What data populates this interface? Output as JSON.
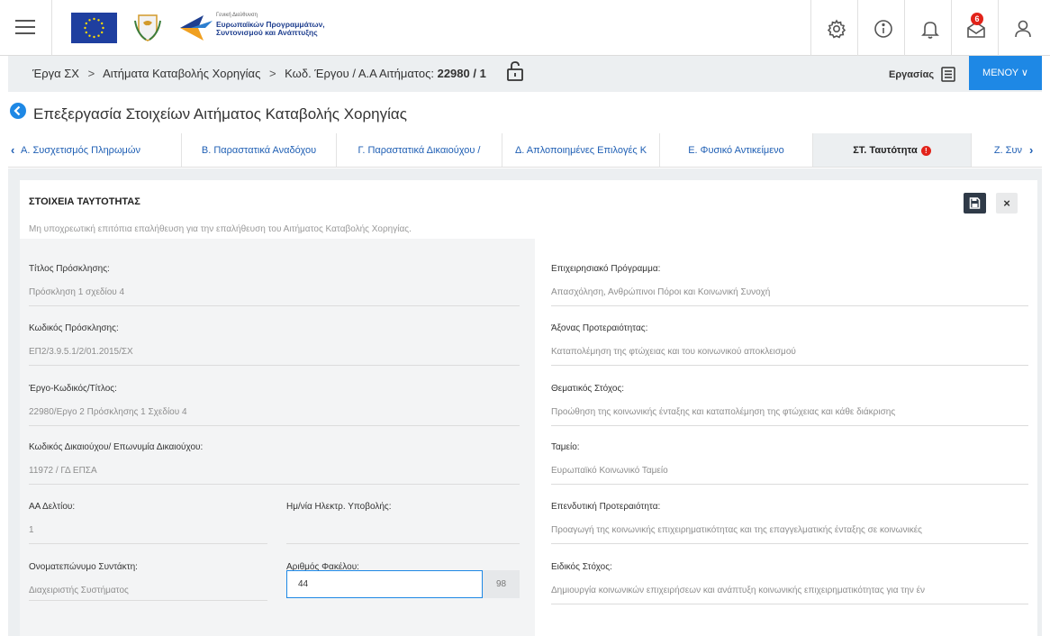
{
  "header": {
    "logo_line1": "Γενική Διεύθυνση",
    "logo_line2": "Ευρωπαϊκών Προγραμμάτων,",
    "logo_line3": "Συντονισμού και Ανάπτυξης",
    "notification_count": "6"
  },
  "breadcrumb": {
    "item1": "Έργα ΣΧ",
    "item2": "Αιτήματα Καταβολής Χορηγίας",
    "item3_prefix": "Κωδ. Έργου / Α.Α Αιτήματος:",
    "item3_value": "22980 / 1",
    "separator": ">",
    "ergasias_label": "Εργασίας",
    "menu_label": "ΜΕΝΟΥ ∨"
  },
  "page": {
    "title": "Επεξεργασία Στοιχείων Αιτήματος Καταβολής Χορηγίας"
  },
  "tabs": [
    {
      "label": "Α. Συσχετισμός Πληρωμών"
    },
    {
      "label": "Β. Παραστατικά Αναδόχου"
    },
    {
      "label": "Γ. Παραστατικά Δικαιούχου / "
    },
    {
      "label": "Δ. Απλοποιημένες Επιλογές Κ"
    },
    {
      "label": "Ε. Φυσικό Αντικείμενο"
    },
    {
      "label": "ΣΤ. Ταυτότητα"
    },
    {
      "label": "Ζ. Συν"
    }
  ],
  "tab_error_mark": "!",
  "section": {
    "title": "ΣΤΟΙΧΕΙΑ ΤΑΥΤΟΤΗΤΑΣ",
    "subtitle": "Μη υποχρεωτική επιτόπια επαλήθευση για την επαλήθευση του Αιτήματος Καταβολής Χορηγίας.",
    "close_label": "×"
  },
  "left_fields": {
    "invitation_title_label": "Τίτλος Πρόσκλησης:",
    "invitation_title_value": "Πρόσκληση 1 σχεδίου 4",
    "invitation_code_label": "Κωδικός Πρόσκλησης:",
    "invitation_code_value": "ΕΠ2/3.9.5.1/2/01.2015/ΣΧ",
    "project_label": "Έργο-Κωδικός/Τίτλος:",
    "project_value": "22980/Εργο 2 Πρόσκλησης 1 Σχεδίου 4",
    "beneficiary_label": "Κωδικός Δικαιούχου/ Επωνυμία Δικαιούχου:",
    "beneficiary_value": "11972 / ΓΔ ΕΠΣΑ",
    "aa_label": "ΑΑ Δελτίου:",
    "aa_value": "1",
    "submission_date_label": "Ημ/νία Ηλεκτρ. Υποβολής:",
    "submission_date_value": "",
    "author_label": "Ονοματεπώνυμο Συντάκτη:",
    "author_value": "Διαχειριστής Συστήματος",
    "folder_label": "Αριθμός Φακέλου:",
    "folder_value": "44",
    "folder_suffix": "98"
  },
  "right_fields": {
    "op_label": "Επιχειρησιακό Πρόγραμμα:",
    "op_value": "Απασχόληση, Ανθρώπινοι Πόροι και Κοινωνική Συνοχή",
    "axis_label": "Άξονας Προτεραιότητας:",
    "axis_value": "Καταπολέμηση της φτώχειας και του κοινωνικού αποκλεισμού",
    "thematic_label": "Θεματικός Στόχος:",
    "thematic_value": "Προώθηση της κοινωνικής ένταξης και καταπολέμηση της φτώχειας και κάθε διάκρισης",
    "fund_label": "Ταμείο:",
    "fund_value": "Ευρωπαϊκό Κοινωνικό Ταμείο",
    "investment_label": "Επενδυτική Προτεραιότητα:",
    "investment_value": "Προαγωγή της κοινωνικής επιχειρηματικότητας και της επαγγελματικής ένταξης σε κοινωνικές",
    "specific_label": "Ειδικός Στόχος:",
    "specific_value": "Δημιουργία κοινωνικών επιχειρήσεων και ανάπτυξη κοινωνικής επιχειρηματικότητας για την έν"
  },
  "icons": {
    "menu": "hamburger-icon",
    "settings": "gear-icon",
    "info": "info-icon",
    "notifications": "bell-icon",
    "messages": "envelope-icon",
    "user": "user-icon",
    "lock": "unlock-icon",
    "back": "back-arrow-icon",
    "save": "save-icon"
  },
  "colors": {
    "accent": "#1e88e5",
    "error": "#e2231a",
    "dark_button": "#2f3a48",
    "panel_bg": "#eceff1"
  }
}
